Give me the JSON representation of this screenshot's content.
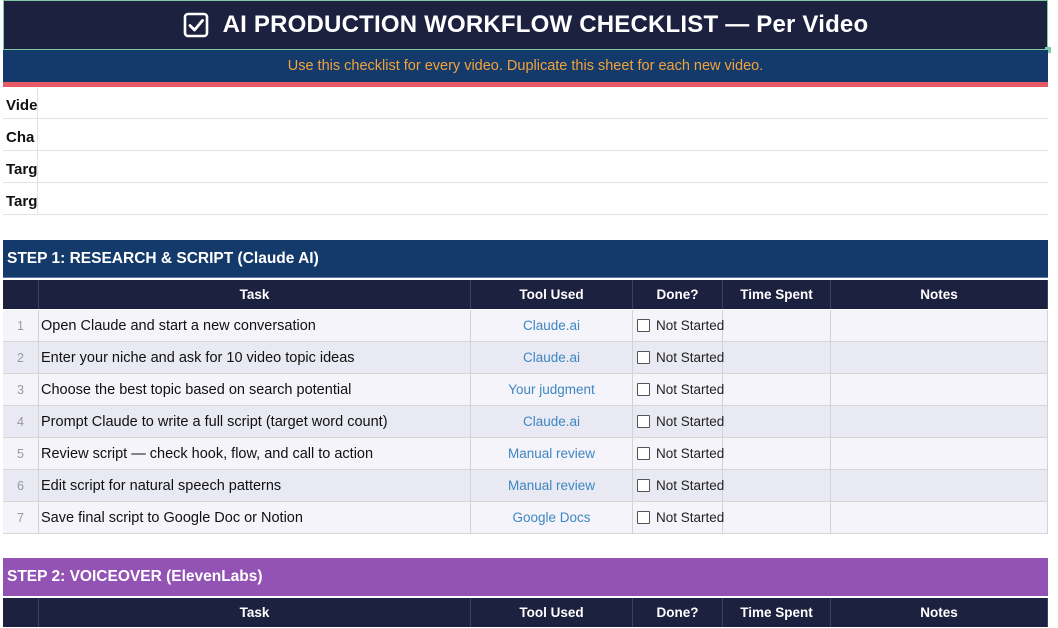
{
  "header": {
    "title": "AI PRODUCTION WORKFLOW CHECKLIST — Per Video",
    "subtitle": "Use this checklist for every video. Duplicate this sheet for each new video."
  },
  "info_fields": [
    {
      "label": "Vide"
    },
    {
      "label": "Cha"
    },
    {
      "label": "Targ"
    },
    {
      "label": "Targ"
    }
  ],
  "step1": {
    "title": "STEP 1: RESEARCH & SCRIPT (Claude AI)",
    "columns": {
      "task": "Task",
      "tool": "Tool Used",
      "done": "Done?",
      "time": "Time Spent",
      "notes": "Notes"
    },
    "rows": [
      {
        "num": "1",
        "task": "Open Claude and start a new conversation",
        "tool": "Claude.ai",
        "status": "Not Started"
      },
      {
        "num": "2",
        "task": "Enter your niche and ask for 10 video topic ideas",
        "tool": "Claude.ai",
        "status": "Not Started"
      },
      {
        "num": "3",
        "task": "Choose the best topic based on search potential",
        "tool": "Your judgment",
        "status": "Not Started"
      },
      {
        "num": "4",
        "task": "Prompt Claude to write a full script (target word count)",
        "tool": "Claude.ai",
        "status": "Not Started"
      },
      {
        "num": "5",
        "task": "Review script — check hook, flow, and call to action",
        "tool": "Manual review",
        "status": "Not Started"
      },
      {
        "num": "6",
        "task": "Edit script for natural speech patterns",
        "tool": "Manual review",
        "status": "Not Started"
      },
      {
        "num": "7",
        "task": "Save final script to Google Doc or Notion",
        "tool": "Google Docs",
        "status": "Not Started"
      }
    ]
  },
  "step2": {
    "title": "STEP 2: VOICEOVER (ElevenLabs)",
    "columns": {
      "task": "Task",
      "tool": "Tool Used",
      "done": "Done?",
      "time": "Time Spent",
      "notes": "Notes"
    }
  }
}
